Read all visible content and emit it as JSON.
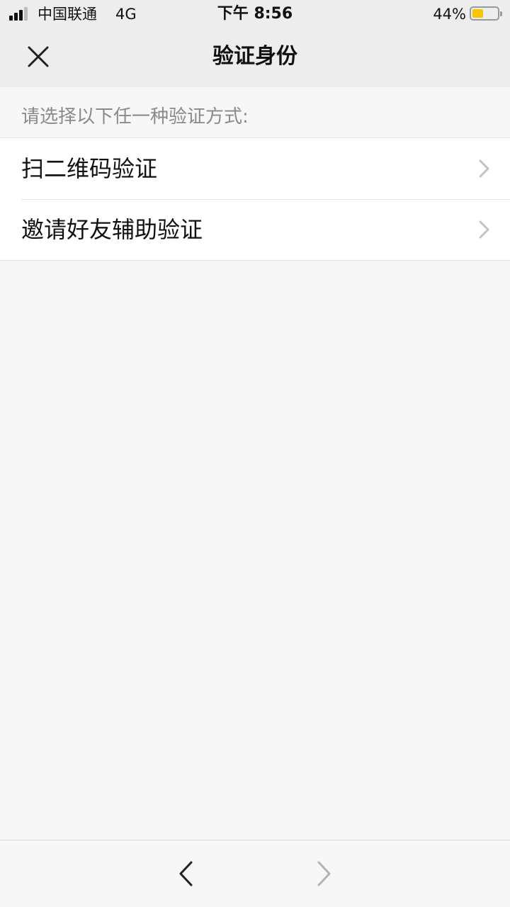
{
  "status_bar": {
    "carrier": "中国联通",
    "network": "4G",
    "time": "下午 8:56",
    "battery_percent": "44%",
    "battery_level": 0.44
  },
  "nav": {
    "title": "验证身份",
    "close_icon": "close-icon"
  },
  "hint": "请选择以下任一种验证方式:",
  "options": [
    {
      "label": "扫二维码验证",
      "icon": "chevron-right-icon"
    },
    {
      "label": "邀请好友辅助验证",
      "icon": "chevron-right-icon"
    }
  ],
  "toolbar": {
    "back_icon": "chevron-left-icon",
    "forward_icon": "chevron-right-icon",
    "forward_enabled": false
  },
  "colors": {
    "header_bg": "#ededed",
    "page_bg": "#f7f7f7",
    "battery_fill": "#f7c600",
    "hint_text": "#8a8a8a",
    "chevron": "#c2c2c2"
  }
}
